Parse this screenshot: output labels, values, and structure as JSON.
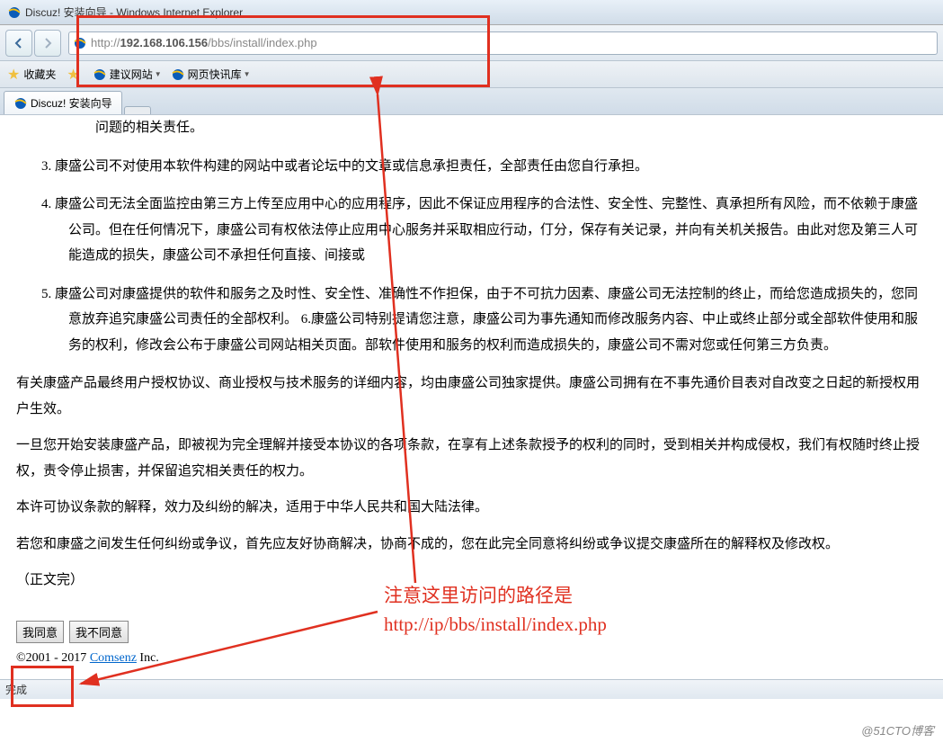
{
  "window": {
    "title": "Discuz! 安装向导 - Windows Internet Explorer"
  },
  "address": {
    "url_prefix": "http://",
    "url_host": "192.168.106.156",
    "url_path": "/bbs/install/index.php"
  },
  "favbar": {
    "favorites": "收藏夹",
    "suggested": "建议网站",
    "quick": "网页快讯库"
  },
  "tabs": {
    "active": "Discuz! 安装向导"
  },
  "content": {
    "li0": "问题的相关责任。",
    "li3_num": "3.",
    "li3": "康盛公司不对使用本软件构建的网站中或者论坛中的文章或信息承担责任，全部责任由您自行承担。",
    "li4_num": "4.",
    "li4": "康盛公司无法全面监控由第三方上传至应用中心的应用程序，因此不保证应用程序的合法性、安全性、完整性、真承担所有风险，而不依赖于康盛公司。但在任何情况下，康盛公司有权依法停止应用中心服务并采取相应行动，仃分，保存有关记录，并向有关机关报告。由此对您及第三人可能造成的损失，康盛公司不承担任何直接、间接或",
    "li5_num": "5.",
    "li5": "康盛公司对康盛提供的软件和服务之及时性、安全性、准确性不作担保，由于不可抗力因素、康盛公司无法控制的终止，而给您造成损失的，您同意放弃追究康盛公司责任的全部权利。 6.康盛公司特别提请您注意，康盛公司为事先通知而修改服务内容、中止或终止部分或全部软件使用和服务的权利，修改会公布于康盛公司网站相关页面。部软件使用和服务的权利而造成损失的，康盛公司不需对您或任何第三方负责。",
    "p1": "有关康盛产品最终用户授权协议、商业授权与技术服务的详细内容，均由康盛公司独家提供。康盛公司拥有在不事先通价目表对自改变之日起的新授权用户生效。",
    "p2": "一旦您开始安装康盛产品，即被视为完全理解并接受本协议的各项条款，在享有上述条款授予的权利的同时，受到相关并构成侵权，我们有权随时终止授权，责令停止损害，并保留追究相关责任的权力。",
    "p3": "本许可协议条款的解释，效力及纠纷的解决，适用于中华人民共和国大陆法律。",
    "p4": "若您和康盛之间发生任何纠纷或争议，首先应友好协商解决，协商不成的，您在此完全同意将纠纷或争议提交康盛所在的解释权及修改权。",
    "end": "（正文完）"
  },
  "buttons": {
    "agree": "我同意",
    "disagree": "我不同意"
  },
  "copyright": {
    "text1": "©2001 - 2017 ",
    "link": "Comsenz",
    "text2": " Inc."
  },
  "status": {
    "text": "完成"
  },
  "annotations": {
    "line1": "注意这里访问的路径是",
    "line2": "http://ip/bbs/install/index.php"
  },
  "watermark": "@51CTO博客"
}
